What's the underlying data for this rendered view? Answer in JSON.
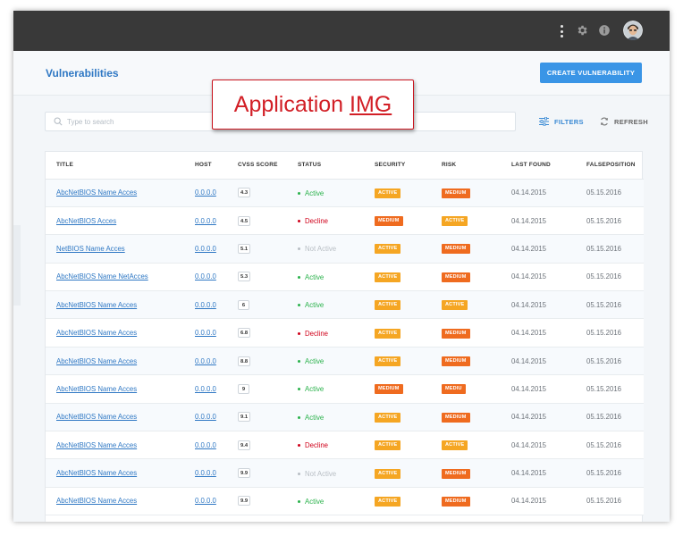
{
  "colors": {
    "topbar": "#393939",
    "accent": "#3a95e6",
    "link": "#2f78c4",
    "status_active": "#2bb24c",
    "status_decline": "#d0021b",
    "status_inactive": "#b8bec4",
    "badge_active": "#f5a623",
    "badge_medium": "#ef6b1f"
  },
  "topbar": {
    "icons": [
      "kebab-menu-icon",
      "gear-icon",
      "info-icon",
      "avatar"
    ]
  },
  "header": {
    "title": "Vulnerabilities",
    "create_button": "CREATE VULNERABILITY"
  },
  "annotation": {
    "text_prefix": "Application ",
    "text_underlined": "IMG"
  },
  "toolbar": {
    "search_placeholder": "Type to search",
    "filters": "FILTERS",
    "refresh": "REFRESH"
  },
  "table": {
    "columns": [
      "TITLE",
      "HOST",
      "CVSS SCORE",
      "STATUS",
      "SECURITY",
      "RISK",
      "LAST FOUND",
      "FALSEPOSITION"
    ],
    "rows": [
      {
        "title": "AbcNetBIOS Name Acces",
        "host": "0.0.0.0",
        "score": "4.3",
        "status": "Active",
        "status_kind": "active",
        "security": "ACTIVE",
        "security_kind": "active",
        "risk": "MEDIUM",
        "risk_kind": "medium",
        "last_found": "04.14.2015",
        "falseposition": "05.15.2016"
      },
      {
        "title": "AbcNetBIOS Acces",
        "host": "0.0.0.0",
        "score": "4.5",
        "status": "Decline",
        "status_kind": "decline",
        "security": "MEDIUM",
        "security_kind": "medium",
        "risk": "ACTIVE",
        "risk_kind": "active",
        "last_found": "04.14.2015",
        "falseposition": "05.15.2016"
      },
      {
        "title": "NetBIOS Name Acces",
        "host": "0.0.0.0",
        "score": "5.1",
        "status": "Not Active",
        "status_kind": "inactive",
        "security": "ACTIVE",
        "security_kind": "active",
        "risk": "MEDIUM",
        "risk_kind": "medium",
        "last_found": "04.14.2015",
        "falseposition": "05.15.2016"
      },
      {
        "title": "AbcNetBIOS Name NetAcces",
        "host": "0.0.0.0",
        "score": "5.3",
        "status": "Active",
        "status_kind": "active",
        "security": "ACTIVE",
        "security_kind": "active",
        "risk": "MEDIUM",
        "risk_kind": "medium",
        "last_found": "04.14.2015",
        "falseposition": "05.15.2016"
      },
      {
        "title": "AbcNetBIOS Name Acces",
        "host": "0.0.0.0",
        "score": "6",
        "status": "Active",
        "status_kind": "active",
        "security": "ACTIVE",
        "security_kind": "active",
        "risk": "ACTIVE",
        "risk_kind": "active",
        "last_found": "04.14.2015",
        "falseposition": "05.15.2016"
      },
      {
        "title": "AbcNetBIOS Name Acces",
        "host": "0.0.0.0",
        "score": "6.8",
        "status": "Decline",
        "status_kind": "decline",
        "security": "ACTIVE",
        "security_kind": "active",
        "risk": "MEDIUM",
        "risk_kind": "medium",
        "last_found": "04.14.2015",
        "falseposition": "05.15.2016"
      },
      {
        "title": "AbcNetBIOS Name Acces",
        "host": "0.0.0.0",
        "score": "8.8",
        "status": "Active",
        "status_kind": "active",
        "security": "ACTIVE",
        "security_kind": "active",
        "risk": "MEDIUM",
        "risk_kind": "medium",
        "last_found": "04.14.2015",
        "falseposition": "05.15.2016"
      },
      {
        "title": "AbcNetBIOS Name Acces",
        "host": "0.0.0.0",
        "score": "9",
        "status": "Active",
        "status_kind": "active",
        "security": "MEDIUM",
        "security_kind": "medium",
        "risk": "MEDIU",
        "risk_kind": "medium",
        "last_found": "04.14.2015",
        "falseposition": "05.15.2016"
      },
      {
        "title": "AbcNetBIOS Name Acces",
        "host": "0.0.0.0",
        "score": "9.1",
        "status": "Active",
        "status_kind": "active",
        "security": "ACTIVE",
        "security_kind": "active",
        "risk": "MEDIUM",
        "risk_kind": "medium",
        "last_found": "04.14.2015",
        "falseposition": "05.15.2016"
      },
      {
        "title": "AbcNetBIOS Name Acces",
        "host": "0.0.0.0",
        "score": "9.4",
        "status": "Decline",
        "status_kind": "decline",
        "security": "ACTIVE",
        "security_kind": "active",
        "risk": "ACTIVE",
        "risk_kind": "active",
        "last_found": "04.14.2015",
        "falseposition": "05.15.2016"
      },
      {
        "title": "AbcNetBIOS Name Acces",
        "host": "0.0.0.0",
        "score": "9.9",
        "status": "Not Active",
        "status_kind": "inactive",
        "security": "ACTIVE",
        "security_kind": "active",
        "risk": "MEDIUM",
        "risk_kind": "medium",
        "last_found": "04.14.2015",
        "falseposition": "05.15.2016"
      },
      {
        "title": "AbcNetBIOS Name Acces",
        "host": "0.0.0.0",
        "score": "9.9",
        "status": "Active",
        "status_kind": "active",
        "security": "ACTIVE",
        "security_kind": "active",
        "risk": "MEDIUM",
        "risk_kind": "medium",
        "last_found": "04.14.2015",
        "falseposition": "05.15.2016"
      }
    ]
  }
}
